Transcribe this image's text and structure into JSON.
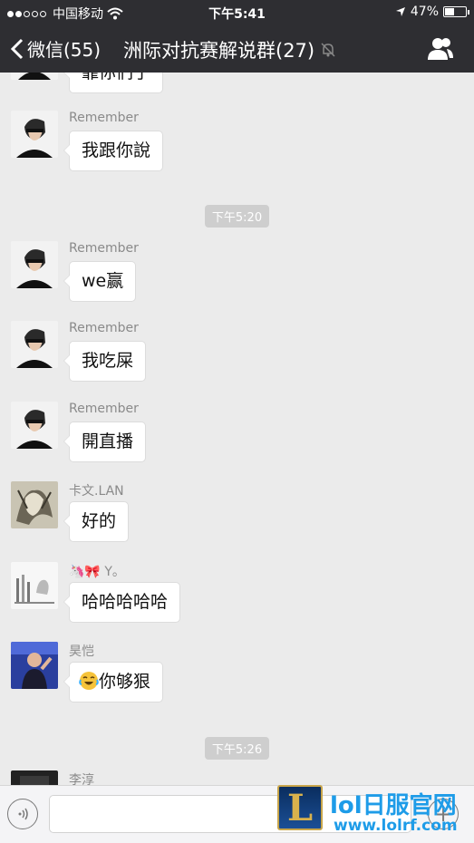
{
  "status_bar": {
    "carrier": "中国移动",
    "time": "下午5:41",
    "battery": "47%",
    "battery_level": 0.47
  },
  "nav": {
    "back_label": "微信(55)",
    "title": "洲际对抗赛解说群(27)"
  },
  "messages": [
    {
      "sender": "",
      "text": "靠你们了",
      "avatar": "remember"
    },
    {
      "sender": "Remember",
      "text": "我跟你說",
      "avatar": "remember"
    },
    {
      "timestamp": "下午5:20"
    },
    {
      "sender": "Remember",
      "text": "we赢",
      "avatar": "remember"
    },
    {
      "sender": "Remember",
      "text": "我吃屎",
      "avatar": "remember"
    },
    {
      "sender": "Remember",
      "text": "開直播",
      "avatar": "remember"
    },
    {
      "sender": "卡文.LAN",
      "text": "好的",
      "avatar": "kawen"
    },
    {
      "sender": "Y。",
      "text": "哈哈哈哈哈",
      "avatar": "y"
    },
    {
      "sender": "昊恺",
      "text": "你够狠",
      "avatar": "haokai",
      "emoji": "laughing-crying"
    },
    {
      "timestamp": "下午5:26"
    },
    {
      "sender": "李淳",
      "text": "",
      "avatar": "lichun"
    }
  ],
  "input_bar": {
    "placeholder": ""
  },
  "watermark": {
    "logo_letter": "L",
    "title": "lol日服官网",
    "url": "www.lolrf.com"
  }
}
